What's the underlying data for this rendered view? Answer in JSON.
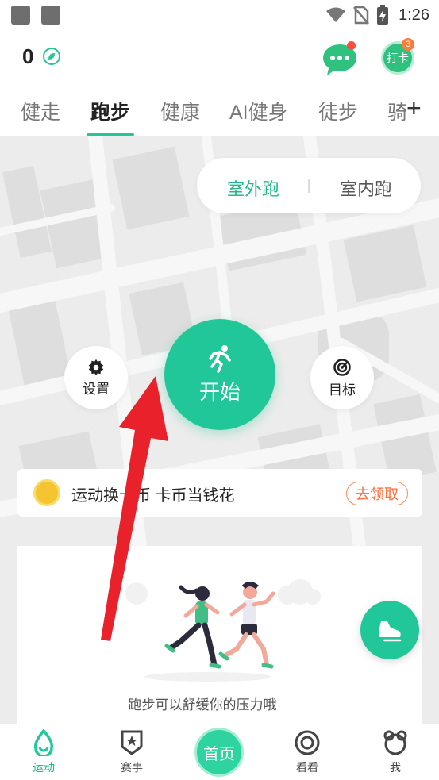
{
  "status_bar": {
    "time": "1:26",
    "icons": [
      "app-square-icon",
      "app-square-icon",
      "wifi-icon",
      "no-sim-icon",
      "battery-charging-icon"
    ]
  },
  "header": {
    "coin_count": "0",
    "coin_icon": "leaf-coin-icon",
    "chat_icon": "chat-bubble-icon",
    "daka_label": "打卡",
    "daka_badge": "3"
  },
  "tabs": {
    "items": [
      "健走",
      "跑步",
      "健康",
      "AI健身",
      "徒步",
      "骑"
    ],
    "active": "跑步",
    "add_icon": "plus-icon"
  },
  "mode_switch": {
    "outdoor": "室外跑",
    "indoor": "室内跑",
    "selected": "室外跑"
  },
  "controls": {
    "settings_label": "设置",
    "start_label": "开始",
    "target_label": "目标"
  },
  "promo": {
    "text": "运动换卡币 卡币当钱花",
    "button": "去领取"
  },
  "illustration": {
    "caption": "跑步可以舒缓你的压力哦"
  },
  "bottom_nav": {
    "items": [
      {
        "label": "运动",
        "icon": "sport-drop-icon",
        "active": true
      },
      {
        "label": "赛事",
        "icon": "medal-star-icon",
        "active": false
      },
      {
        "label": "首页",
        "icon": "home-icon",
        "active": false
      },
      {
        "label": "看看",
        "icon": "look-icon",
        "active": false
      },
      {
        "label": "我",
        "icon": "profile-icon",
        "active": false
      }
    ]
  },
  "colors": {
    "accent": "#22c799",
    "promo_orange": "#ff6b35",
    "arrow_red": "#e8212b"
  }
}
